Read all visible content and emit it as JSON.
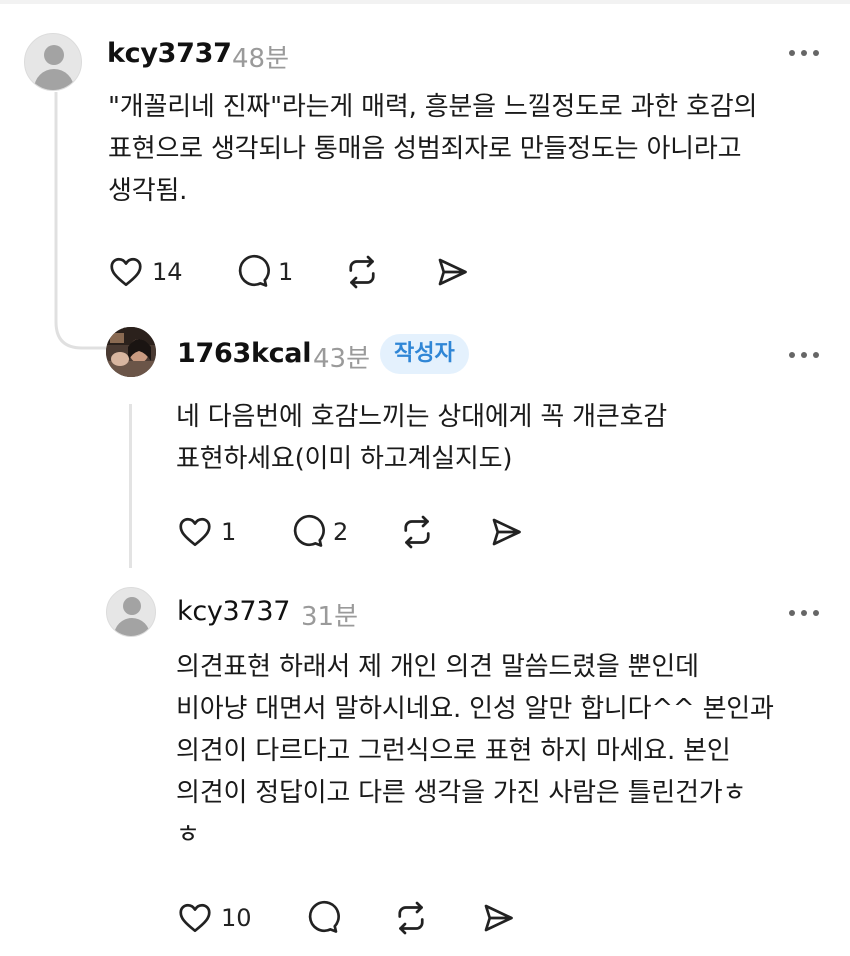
{
  "comments": [
    {
      "username": "kcy3737",
      "time": "48분",
      "text": "\"개꼴리네 진짜\"라는게 매력, 흥분을 느낄정도로 과한 호감의\n표현으로 생각되나 통매음 성범죄자로 만들정도는 아니라고\n생각됨.",
      "likes": "14",
      "replies": "1"
    },
    {
      "username": "1763kcal",
      "time": "43분",
      "badge": "작성자",
      "text": "네 다음번에 호감느끼는 상대에게 꼭 개큰호감\n표현하세요(이미 하고계실지도)",
      "likes": "1",
      "replies": "2"
    },
    {
      "username": "kcy3737",
      "time": "31분",
      "text": "의견표현 하래서 제 개인 의견 말씀드렸을 뿐인데\n비아냥 대면서 말하시네요. 인성 알만 합니다^^ 본인과\n의견이 다르다고 그런식으로 표현 하지 마세요. 본인\n의견이 정답이고 다른 생각을 가진 사람은 틀린건가ㅎ\nㅎ",
      "likes": "10",
      "replies": ""
    }
  ],
  "icons": {
    "like": "heart-icon",
    "reply": "comment-icon",
    "repost": "repost-icon",
    "share": "send-icon",
    "more": "more-icon"
  }
}
